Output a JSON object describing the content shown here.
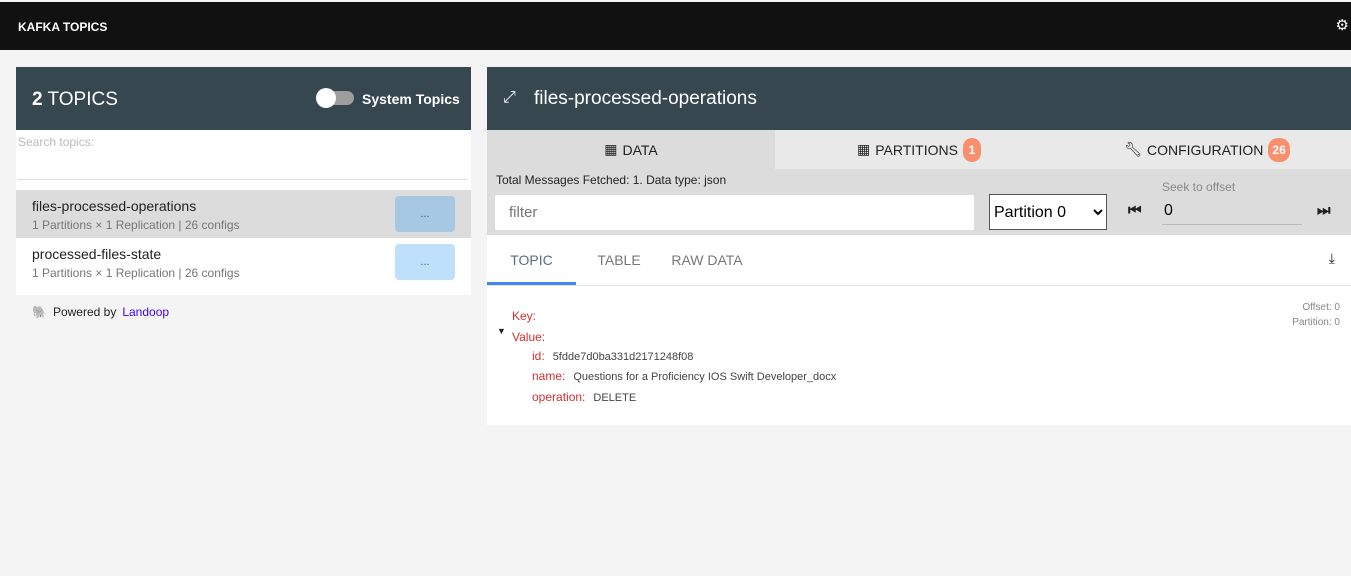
{
  "app": {
    "title": "KAFKA TOPICS",
    "settings_icon": "gear-icon"
  },
  "sidebar": {
    "count": "2",
    "count_label": "TOPICS",
    "system_topics_label": "System Topics",
    "system_topics_on": false,
    "search_placeholder": "Search topics:",
    "topics": [
      {
        "name": "files-processed-operations",
        "meta": "1 Partitions × 1 Replication | 26 configs",
        "action": "...",
        "selected": true
      },
      {
        "name": "processed-files-state",
        "meta": "1 Partitions × 1 Replication | 26 configs",
        "action": "...",
        "selected": false
      }
    ],
    "powered_by": "Powered by",
    "powered_link": "Landoop"
  },
  "topic": {
    "title": "files-processed-operations",
    "tabs": [
      {
        "label": "DATA"
      },
      {
        "label": "PARTITIONS",
        "badge": "1"
      },
      {
        "label": "CONFIGURATION",
        "badge": "26"
      }
    ],
    "info": "Total Messages Fetched: 1. Data type: json",
    "filter_placeholder": "filter",
    "partition": "Partition 0",
    "seek_label": "Seek to offset",
    "offset": "0",
    "subtabs": [
      "TOPIC",
      "TABLE",
      "RAW DATA"
    ],
    "message": {
      "key_label": "Key:",
      "value_label": "Value:",
      "offset": "Offset: 0",
      "partition": "Partition: 0",
      "fields": [
        {
          "k": "id:",
          "v": "5fdde7d0ba331d2171248f08"
        },
        {
          "k": "name:",
          "v": "Questions for a Proficiency IOS Swift Developer_docx"
        },
        {
          "k": "operation:",
          "v": "DELETE"
        }
      ]
    }
  }
}
